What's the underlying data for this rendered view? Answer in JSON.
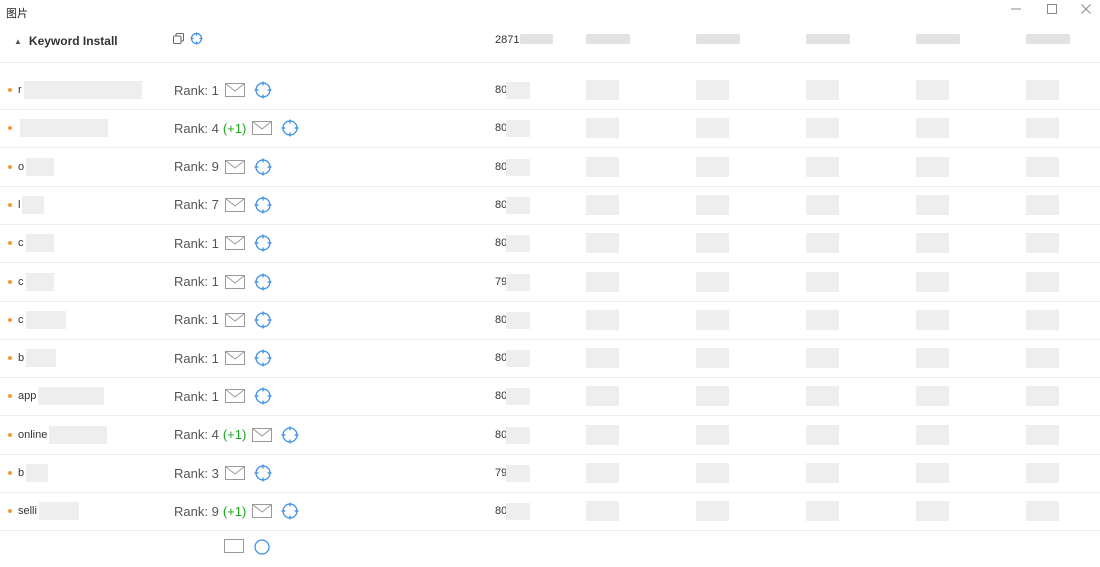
{
  "window": {
    "title": "图片"
  },
  "table": {
    "header": {
      "label": "Keyword Install",
      "total": "2871"
    },
    "rows": [
      {
        "keyword": "r",
        "rank_text": "Rank: 1",
        "delta": "",
        "value": "80"
      },
      {
        "keyword": "",
        "rank_text": "Rank: 4",
        "delta": "(+1)",
        "value": "80"
      },
      {
        "keyword": "o",
        "rank_text": "Rank: 9",
        "delta": "",
        "value": "80"
      },
      {
        "keyword": "l",
        "rank_text": "Rank: 7",
        "delta": "",
        "value": "80"
      },
      {
        "keyword": "c",
        "rank_text": "Rank: 1",
        "delta": "",
        "value": "80"
      },
      {
        "keyword": "c",
        "rank_text": "Rank: 1",
        "delta": "",
        "value": "79"
      },
      {
        "keyword": "c",
        "rank_text": "Rank: 1",
        "delta": "",
        "value": "80"
      },
      {
        "keyword": "b",
        "rank_text": "Rank: 1",
        "delta": "",
        "value": "80"
      },
      {
        "keyword": "app",
        "rank_text": "Rank: 1",
        "delta": "",
        "value": "80"
      },
      {
        "keyword": "online",
        "rank_text": "Rank: 4",
        "delta": "(+1)",
        "value": "80"
      },
      {
        "keyword": "b",
        "rank_text": "Rank: 3",
        "delta": "",
        "value": "79"
      },
      {
        "keyword": "selli",
        "rank_text": "Rank: 9",
        "delta": "(+1)",
        "value": "80"
      }
    ]
  },
  "colors": {
    "accent_icon": "#3c8fe6",
    "bullet": "#f39c34",
    "rank_up": "#1ba61b"
  },
  "icons": {
    "header": [
      "copy-icon",
      "target-icon"
    ],
    "row": [
      "mail-icon",
      "target-icon"
    ],
    "window": [
      "minimize-icon",
      "maximize-icon",
      "close-icon"
    ]
  }
}
